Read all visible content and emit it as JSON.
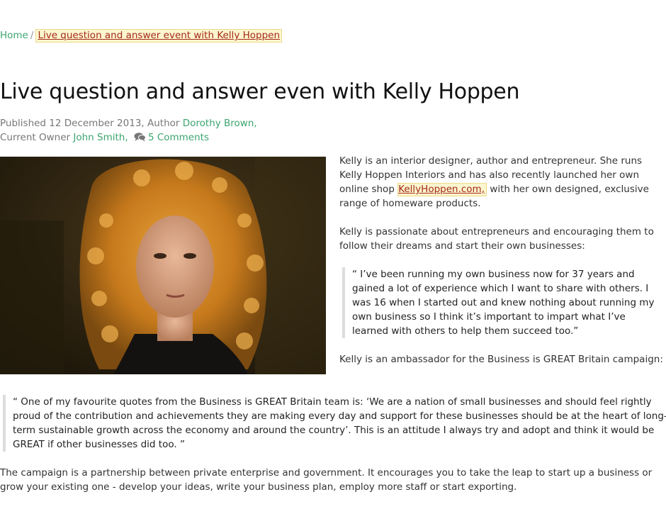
{
  "breadcrumb": {
    "home": "Home",
    "separator": "/",
    "current": "Live question and answer event with Kelly Hoppen"
  },
  "article": {
    "title": "Live question and answer even with Kelly Hoppen",
    "meta": {
      "published_prefix": "Published 12 December 2013, Author ",
      "author": "Dorothy Brown,",
      "owner_prefix": "Current Owner ",
      "owner": "John Smith,",
      "comments": "5 Comments"
    },
    "intro_before_link": "Kelly is an interior designer, author and entrepreneur. She runs Kelly Hoppen Interiors and has also recently launched her own online shop ",
    "intro_link": "KellyHoppen.com,",
    "intro_after_link": " with her own designed, exclusive range of homeware products.",
    "para2": "Kelly is passionate about entrepreneurs and encouraging them to follow their dreams and start their own businesses:",
    "quote1": "“ I’ve been running my own business now for 37 years and gained a lot of experience which I want to share with others. I was 16 when I started out and knew nothing about running my own business so I think it’s important to impart what I’ve learned with others to help them succeed too.”",
    "para3": "Kelly is an ambassador for the Business is GREAT Britain campaign:",
    "quote2": "“ One of my favourite quotes from the Business is GREAT Britain team is: ‘We are a nation of small businesses and should feel rightly proud of the contribution and achievements they are making every day and support for these businesses should be at the heart of long-term sustainable growth across the economy and around the country’. This is an attitude I always try and adopt and think it would be GREAT if other businesses did too. ”",
    "para4": "The campaign is a partnership between private enterprise and government. It encourages you to take the leap to start up a business or grow your existing one - develop your ideas, write your business plan, employ more staff or start exporting."
  },
  "colors": {
    "link_green": "#3ca56f",
    "link_red": "#a52a1a",
    "highlight": "#fbf6cf"
  },
  "icons": {
    "comment": "comment-bubbles-icon"
  }
}
